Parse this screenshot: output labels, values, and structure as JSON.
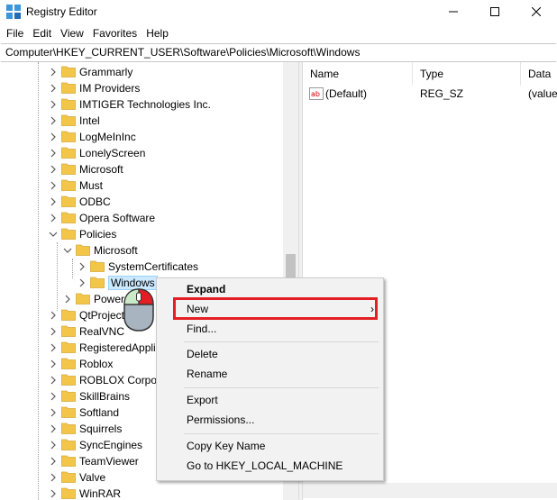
{
  "window": {
    "title": "Registry Editor",
    "buttons": {
      "minimize": "—",
      "maximize": "☐",
      "close": "✕"
    }
  },
  "menu": [
    "File",
    "Edit",
    "View",
    "Favorites",
    "Help"
  ],
  "address": "Computer\\HKEY_CURRENT_USER\\Software\\Policies\\Microsoft\\Windows",
  "tree": [
    {
      "label": "Grammarly",
      "level": 0,
      "expanded": false
    },
    {
      "label": "IM Providers",
      "level": 0,
      "expanded": false
    },
    {
      "label": "IMTIGER Technologies Inc.",
      "level": 0,
      "expanded": false
    },
    {
      "label": "Intel",
      "level": 0,
      "expanded": false
    },
    {
      "label": "LogMeInInc",
      "level": 0,
      "expanded": false
    },
    {
      "label": "LonelyScreen",
      "level": 0,
      "expanded": false
    },
    {
      "label": "Microsoft",
      "level": 0,
      "expanded": false
    },
    {
      "label": "Must",
      "level": 0,
      "expanded": false
    },
    {
      "label": "ODBC",
      "level": 0,
      "expanded": false
    },
    {
      "label": "Opera Software",
      "level": 0,
      "expanded": false
    },
    {
      "label": "Policies",
      "level": 0,
      "expanded": true
    },
    {
      "label": "Microsoft",
      "level": 1,
      "expanded": true
    },
    {
      "label": "SystemCertificates",
      "level": 2,
      "expanded": false
    },
    {
      "label": "Windows",
      "level": 2,
      "expanded": false,
      "selected": true
    },
    {
      "label": "Power",
      "level": 1,
      "expanded": false
    },
    {
      "label": "QtProject",
      "level": 0,
      "expanded": false
    },
    {
      "label": "RealVNC",
      "level": 0,
      "expanded": false
    },
    {
      "label": "RegisteredAppli",
      "level": 0,
      "expanded": false
    },
    {
      "label": "Roblox",
      "level": 0,
      "expanded": false
    },
    {
      "label": "ROBLOX Corpo",
      "level": 0,
      "expanded": false
    },
    {
      "label": "SkillBrains",
      "level": 0,
      "expanded": false
    },
    {
      "label": "Softland",
      "level": 0,
      "expanded": false
    },
    {
      "label": "Squirrels",
      "level": 0,
      "expanded": false
    },
    {
      "label": "SyncEngines",
      "level": 0,
      "expanded": false
    },
    {
      "label": "TeamViewer",
      "level": 0,
      "expanded": false
    },
    {
      "label": "Valve",
      "level": 0,
      "expanded": false
    },
    {
      "label": "WinRAR",
      "level": 0,
      "expanded": false
    }
  ],
  "list": {
    "columns": [
      "Name",
      "Type",
      "Data"
    ],
    "rows": [
      {
        "icon": "ab",
        "name": "(Default)",
        "type": "REG_SZ",
        "data": "(value"
      }
    ]
  },
  "context_menu": {
    "items": [
      {
        "label": "Expand",
        "bold": true
      },
      {
        "label": "New",
        "submenu": true,
        "highlighted": true
      },
      {
        "label": "Find..."
      },
      {
        "label": "Delete"
      },
      {
        "label": "Rename"
      },
      {
        "label": "Export"
      },
      {
        "label": "Permissions..."
      },
      {
        "label": "Copy Key Name"
      },
      {
        "label": "Go to HKEY_LOCAL_MACHINE"
      }
    ],
    "submenu_arrow": "›"
  },
  "colors": {
    "folder": "#f3c649",
    "selection": "#cce8ff",
    "highlight_box": "#e31e24",
    "mouse_left": "#e31e24"
  }
}
